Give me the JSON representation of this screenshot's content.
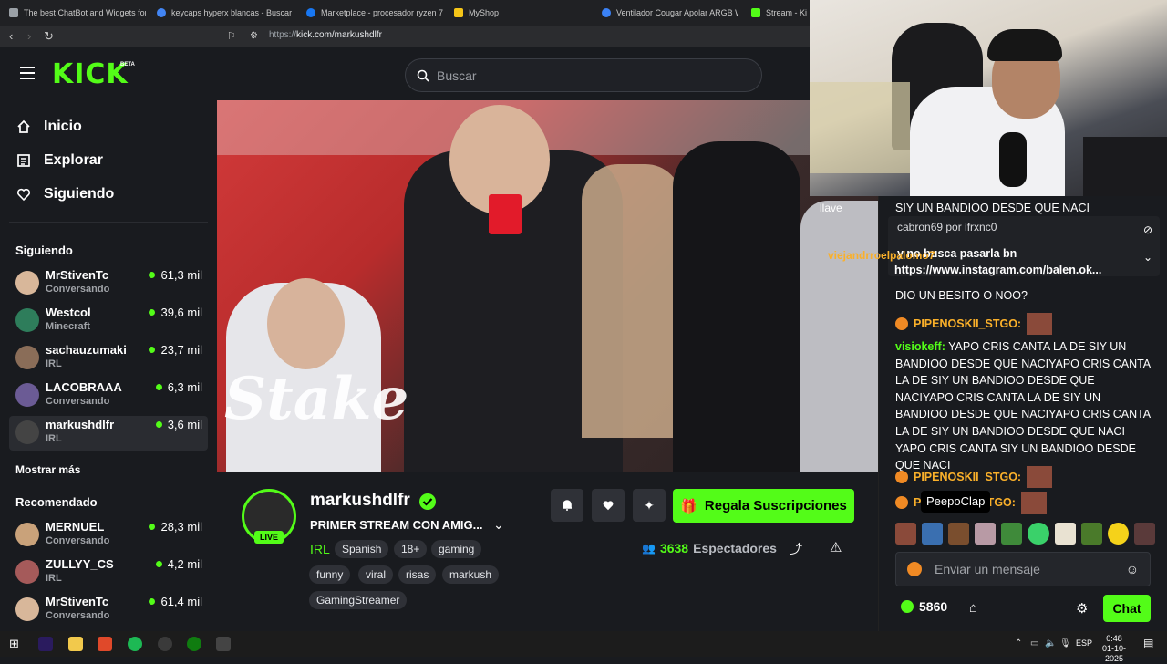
{
  "browser": {
    "tabs": [
      {
        "label": "The best ChatBot and Widgets for Ki",
        "color": "#9aa0a6"
      },
      {
        "label": "keycaps hyperx blancas - Buscar con",
        "color": "#4285f4"
      },
      {
        "label": "Marketplace - procesador ryzen 7 5",
        "color": "#1877f2"
      },
      {
        "label": "MyShop",
        "color": "#f5c518"
      },
      {
        "label": "Ventilador Cougar Apolar ARGB Whi",
        "color": "#3b82f6"
      },
      {
        "label": "Stream - Ki",
        "color": "#53fc18"
      }
    ],
    "url_prefix": "https://",
    "url": "kick.com/markushdlfr"
  },
  "header": {
    "logo": "KICK",
    "beta": "BETA",
    "search_placeholder": "Buscar"
  },
  "sidebar": {
    "nav": [
      {
        "label": "Inicio",
        "icon": "home-icon"
      },
      {
        "label": "Explorar",
        "icon": "compass-icon"
      },
      {
        "label": "Siguiendo",
        "icon": "heart-icon"
      }
    ],
    "following_title": "Siguiendo",
    "following": [
      {
        "name": "MrStivenTc",
        "sub": "Conversando",
        "viewers": "61,3 mil",
        "avatar_color": "#d8b79a"
      },
      {
        "name": "Westcol",
        "sub": "Minecraft",
        "viewers": "39,6 mil",
        "avatar_color": "#2e7d5b"
      },
      {
        "name": "sachauzumaki",
        "sub": "IRL",
        "viewers": "23,7 mil",
        "avatar_color": "#8a6d58"
      },
      {
        "name": "LACOBRAAA",
        "sub": "Conversando",
        "viewers": "6,3 mil",
        "avatar_color": "#6b5b95"
      },
      {
        "name": "markushdlfr",
        "sub": "IRL",
        "viewers": "3,6 mil",
        "avatar_color": "#444444"
      }
    ],
    "show_more": "Mostrar más",
    "recommended_title": "Recomendado",
    "recommended": [
      {
        "name": "MERNUEL",
        "sub": "Conversando",
        "viewers": "28,3 mil",
        "avatar_color": "#c9a27a"
      },
      {
        "name": "ZULLYY_CS",
        "sub": "IRL",
        "viewers": "4,2 mil",
        "avatar_color": "#a55a5a"
      },
      {
        "name": "MrStivenTc",
        "sub": "Conversando",
        "viewers": "61,4 mil",
        "avatar_color": "#d8b79a"
      }
    ]
  },
  "video": {
    "watermark": "Stake"
  },
  "stream": {
    "channel": "markushdlfr",
    "title": "PRIMER STREAM CON AMIG...",
    "live_badge": "LIVE",
    "category": "IRL",
    "tags_row1": [
      "Spanish",
      "18+",
      "gaming"
    ],
    "tags_row2": [
      "funny",
      "viral",
      "risas",
      "markush"
    ],
    "tags_row3": [
      "GamingStreamer"
    ],
    "gift_button": "Regala Suscripciones",
    "viewers_count": "3638",
    "viewers_label": "Espectadores"
  },
  "chat": {
    "overlay_lines": [
      {
        "text": "llave"
      },
      {
        "text": "cabron69 por ifrxnc0"
      },
      {
        "text": "viejandrroelpalomo7"
      }
    ],
    "pinned_top": "SIY UN BANDIOO DESDE QUE NACI",
    "pinned_msg": "y no busca pasarla bn",
    "pinned_link": "https://www.instagram.com/balen.ok...",
    "messages": [
      {
        "user": "",
        "text": "DIO UN BESITO O NOO?"
      },
      {
        "user": "PIPENOSKII_STGO:",
        "text": ""
      },
      {
        "user": "visiokeff:",
        "text": "YAPO CRIS CANTA LA DE SIY UN BANDIOO DESDE QUE NACIYAPO CRIS CANTA LA DE SIY UN BANDIOO DESDE QUE NACIYAPO CRIS CANTA LA DE SIY UN BANDIOO DESDE QUE NACIYAPO CRIS CANTA LA DE SIY UN BANDIOO DESDE QUE NACI YAPO CRIS CANTA SIY UN BANDIOO DESDE QUE NACI"
      },
      {
        "user": "PIPENOSKII_STGO:",
        "text": ""
      },
      {
        "user": "P",
        "text": "STGO:"
      }
    ],
    "tooltip": "PeepoClap",
    "input_placeholder": "Enviar un mensaje",
    "points": "5860",
    "chat_button": "Chat"
  },
  "taskbar": {
    "lang": "ESP",
    "time": "0:48",
    "date": "01-10-2025"
  }
}
